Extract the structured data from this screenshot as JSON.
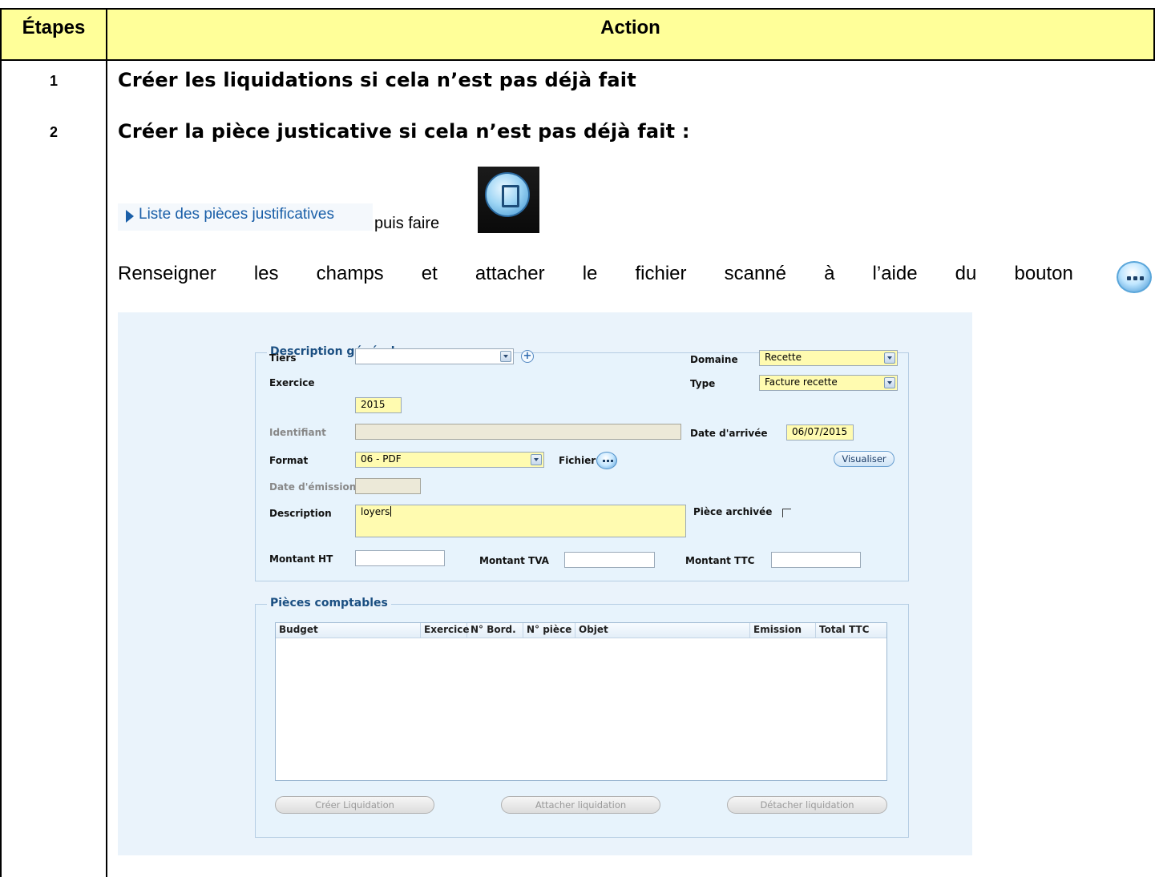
{
  "table": {
    "header_steps": "Étapes",
    "header_action": "Action"
  },
  "steps": [
    {
      "number": "1",
      "title": "Créer les liquidations si cela n’est pas déjà fait"
    },
    {
      "number": "2",
      "title": "Créer la pièce justicative si cela n’est pas déjà fait :"
    }
  ],
  "link_label": "Liste des pièces justificatives",
  "puis_faire": "puis faire",
  "instruction_words": [
    "Renseigner",
    "les",
    "champs",
    "et",
    "attacher",
    "le",
    "fichier",
    "scanné",
    "à",
    "l’aide",
    "du",
    "bouton"
  ],
  "form": {
    "general_legend": "Description générale",
    "tiers_label": "Tiers",
    "tiers_value": "",
    "exercice_label": "Exercice",
    "exercice_value": "2015",
    "identifiant_label": "Identifiant",
    "format_label": "Format",
    "format_value": "06 - PDF",
    "fichier_label": "Fichier",
    "date_emission_label": "Date d'émission",
    "description_label": "Description",
    "description_value": "loyers",
    "montant_ht_label": "Montant HT",
    "montant_tva_label": "Montant TVA",
    "montant_ttc_label": "Montant TTC",
    "domaine_label": "Domaine",
    "domaine_value": "Recette",
    "type_label": "Type",
    "type_value": "Facture recette",
    "date_arrivee_label": "Date d'arrivée",
    "date_arrivee_value": "06/07/2015",
    "visualiser_label": "Visualiser",
    "piece_archivee_label": "Pièce archivée",
    "piece_archivee_checked": false
  },
  "pieces": {
    "legend": "Pièces comptables",
    "columns": [
      "Budget",
      "Exercice",
      "N° Bord.",
      "N° pièce",
      "Objet",
      "Emission",
      "Total TTC"
    ],
    "rows": [],
    "creer_liquidation": "Créer Liquidation",
    "attacher_liquidation": "Attacher liquidation",
    "detacher_liquidation": "Détacher liquidation"
  },
  "colors": {
    "header_bg": "#ffff99",
    "link_blue": "#1a5fa8",
    "legend_blue": "#1b4f82",
    "field_yellow": "#fffbb0"
  }
}
